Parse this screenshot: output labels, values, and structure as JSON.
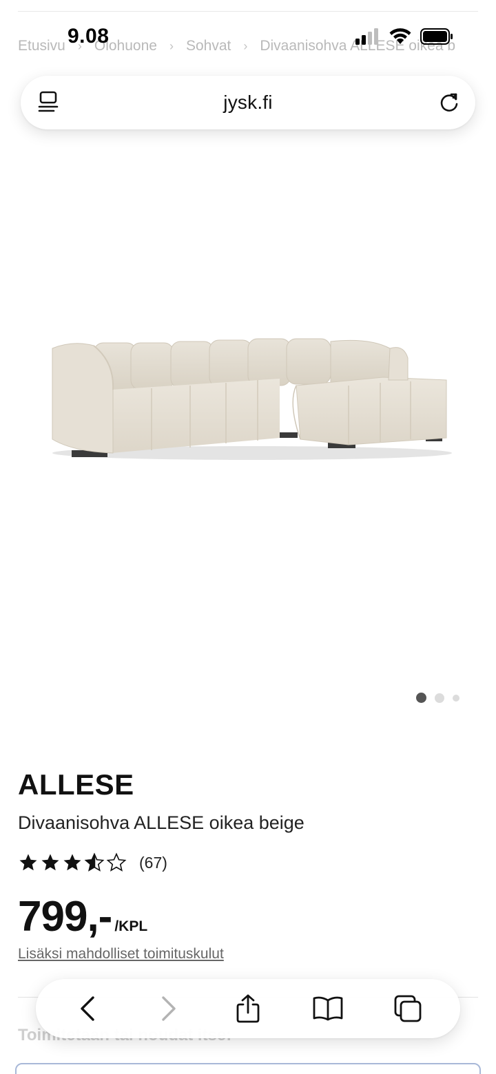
{
  "status_bar": {
    "time": "9.08"
  },
  "breadcrumb": [
    "Etusivu",
    "Olohuone",
    "Sohvat",
    "Divaanisohva ALLESE oikea b"
  ],
  "address_bar": {
    "url": "jysk.fi"
  },
  "gallery": {
    "image_count": 3,
    "active_index": 0
  },
  "product": {
    "name": "ALLESE",
    "description": "Divaanisohva ALLESE oikea beige",
    "rating": 3.5,
    "rating_max": 5,
    "review_count": "(67)",
    "price": "799,-",
    "price_unit": "/KPL",
    "shipping_link": "Lisäksi mahdolliset toimituskulut"
  },
  "delivery": {
    "heading": "Toimitetaan tai noudat itse:"
  },
  "toolbar": {
    "back": "back-icon",
    "forward": "forward-icon",
    "share": "share-icon",
    "bookmarks": "book-icon",
    "tabs": "tabs-icon"
  }
}
